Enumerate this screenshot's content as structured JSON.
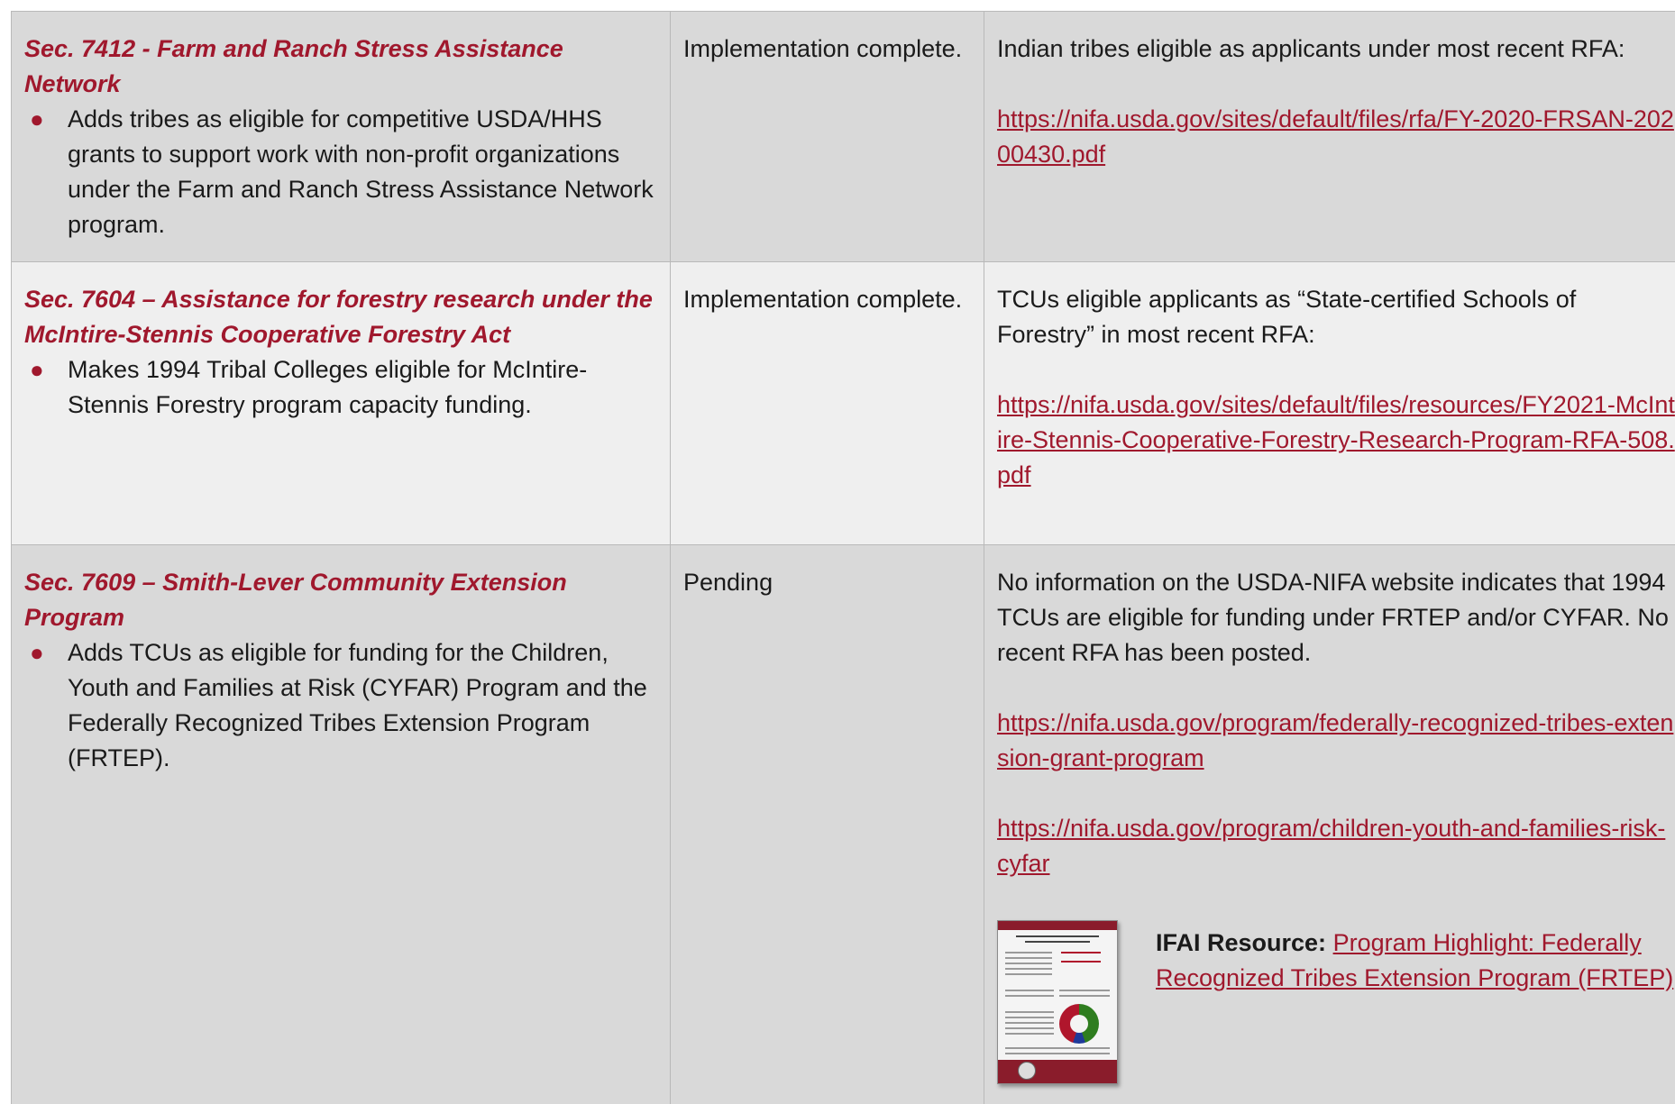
{
  "rows": [
    {
      "title": "Sec. 7412 - Farm and Ranch Stress Assistance Network",
      "bullet": "Adds tribes as eligible for competitive USDA/HHS grants to support work with non-profit organizations under the Farm and Ranch Stress Assistance Network program.",
      "status": "Implementation complete.",
      "notes": "Indian tribes eligible as applicants under most recent RFA:",
      "links": [
        "https://nifa.usda.gov/sites/default/files/rfa/FY-2020-FRSAN-20200430.pdf"
      ]
    },
    {
      "title": "Sec. 7604 – Assistance for forestry research under the McIntire-Stennis Cooperative Forestry Act",
      "bullet": "Makes 1994 Tribal Colleges eligible for McIntire-Stennis Forestry program capacity funding.",
      "status": "Implementation complete.",
      "notes": "TCUs eligible applicants as “State-certified Schools of Forestry” in most recent RFA:",
      "links": [
        "https://nifa.usda.gov/sites/default/files/resources/FY2021-McIntire-Stennis-Cooperative-Forestry-Research-Program-RFA-508.pdf"
      ]
    },
    {
      "title": "Sec. 7609 – Smith-Lever Community Extension Program",
      "bullet": "Adds TCUs as eligible for funding for the Children, Youth and Families at Risk (CYFAR) Program and the Federally Recognized Tribes Extension Program (FRTEP).",
      "status": "Pending",
      "notes": "No information on the USDA-NIFA website indicates that 1994 TCUs are eligible for funding under FRTEP and/or CYFAR. No recent RFA has been posted.",
      "links": [
        "https://nifa.usda.gov/program/federally-recognized-tribes-extension-grant-program",
        "https://nifa.usda.gov/program/children-youth-and-families-risk-cyfar"
      ],
      "resource": {
        "label": "IFAI Resource:",
        "link_text": "Program Highlight: Federally Recognized Tribes Extension Program (FRTEP)"
      }
    }
  ]
}
